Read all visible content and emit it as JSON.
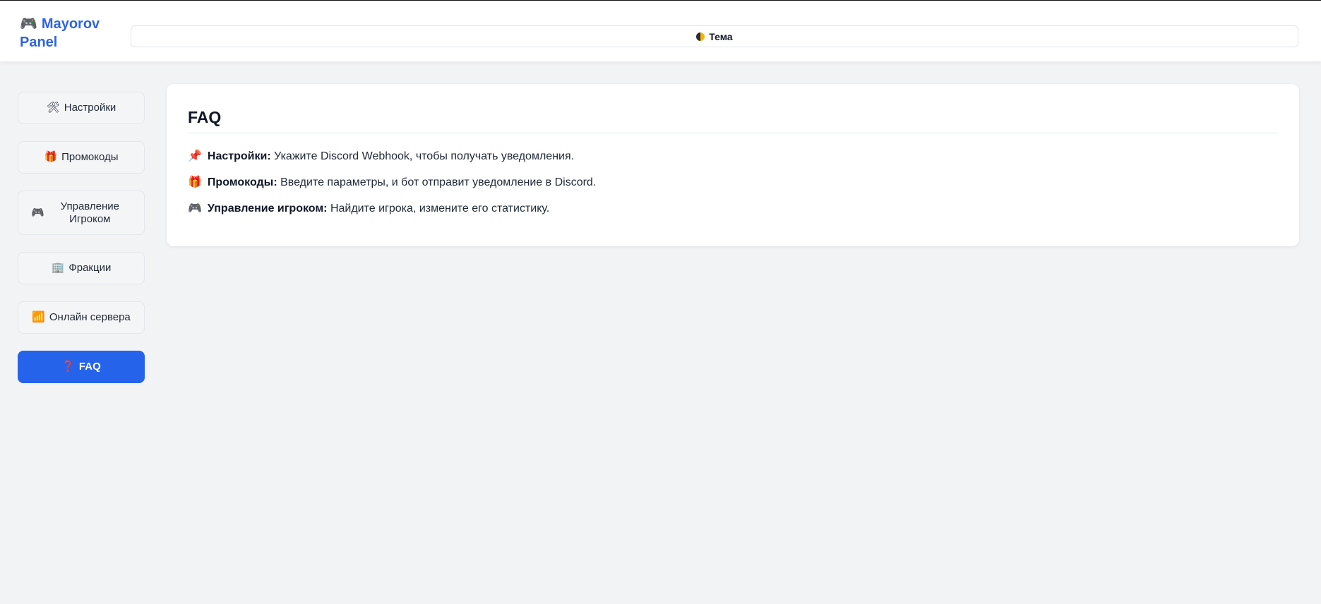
{
  "header": {
    "logo_icon": "🎮",
    "logo_text": "Mayorov Panel",
    "theme_icon": "half-moon-icon",
    "theme_label": "Тема"
  },
  "sidebar": {
    "items": [
      {
        "icon": "🛠",
        "label": "Настройки",
        "active": false
      },
      {
        "icon": "🎁",
        "label": "Промокоды",
        "active": false
      },
      {
        "icon": "🎮",
        "label": "Управление Игроком",
        "active": false
      },
      {
        "icon": "🏢",
        "label": "Фракции",
        "active": false
      },
      {
        "icon": "📶",
        "label": "Онлайн сервера",
        "active": false
      },
      {
        "icon": "❓",
        "label": "FAQ",
        "active": true
      }
    ]
  },
  "main": {
    "title": "FAQ",
    "faq": [
      {
        "icon": "📌",
        "term": "Настройки:",
        "text": " Укажите Discord Webhook, чтобы получать уведомления."
      },
      {
        "icon": "🎁",
        "term": "Промокоды:",
        "text": " Введите параметры, и бот отправит уведомление в Discord."
      },
      {
        "icon": "🎮",
        "term": "Управление игроком:",
        "text": " Найдите игрока, измените его статистику."
      }
    ]
  },
  "colors": {
    "accent": "#2563eb",
    "logo": "#2f64e0",
    "background": "#f2f3f5"
  }
}
